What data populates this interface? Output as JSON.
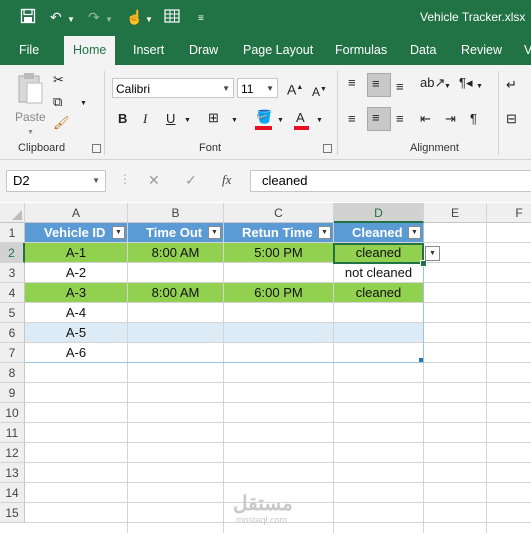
{
  "window": {
    "title": "Vehicle Tracker.xlsx"
  },
  "ribbon": {
    "tabs": [
      "File",
      "Home",
      "Insert",
      "Draw",
      "Page Layout",
      "Formulas",
      "Data",
      "Review",
      "V"
    ],
    "active_tab": "Home",
    "clipboard": {
      "paste_label": "Paste",
      "group_label": "Clipboard"
    },
    "font": {
      "name": "Calibri",
      "size": "11",
      "group_label": "Font"
    },
    "alignment": {
      "group_label": "Alignment"
    }
  },
  "formula_bar": {
    "name_box": "D2",
    "value": "cleaned",
    "fx": "fx"
  },
  "sheet": {
    "columns": [
      "A",
      "B",
      "C",
      "D",
      "E",
      "F"
    ],
    "rows": [
      "1",
      "2",
      "3",
      "4",
      "5",
      "6",
      "7",
      "8",
      "9",
      "10",
      "11",
      "12",
      "13",
      "14",
      "15"
    ],
    "headers": [
      "Vehicle ID",
      "Time Out",
      "Retun Time",
      "Cleaned"
    ],
    "data": [
      [
        "A-1",
        "8:00 AM",
        "5:00 PM",
        "cleaned"
      ],
      [
        "A-2",
        "",
        "",
        "not cleaned"
      ],
      [
        "A-3",
        "8:00 AM",
        "6:00 PM",
        "cleaned"
      ],
      [
        "A-4",
        "",
        "",
        ""
      ],
      [
        "A-5",
        "",
        "",
        ""
      ],
      [
        "A-6",
        "",
        "",
        ""
      ]
    ]
  },
  "colors": {
    "green": "#92d050",
    "header": "#5b9bd5",
    "accent": "#217346"
  },
  "watermark": {
    "text": "مستقل",
    "sub": "mostaql.com"
  }
}
